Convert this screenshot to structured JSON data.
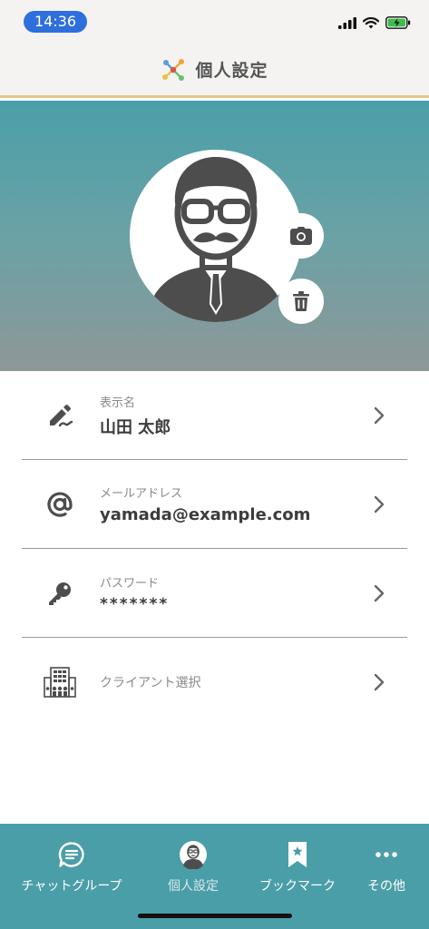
{
  "status_bar": {
    "time": "14:36"
  },
  "header": {
    "title": "個人設定"
  },
  "profile": {
    "camera_icon": "camera-icon",
    "trash_icon": "trash-icon"
  },
  "list": {
    "items": [
      {
        "icon": "pencil-icon",
        "label": "表示名",
        "value": "山田 太郎"
      },
      {
        "icon": "at-sign-icon",
        "label": "メールアドレス",
        "value": "yamada@example.com"
      },
      {
        "icon": "key-icon",
        "label": "パスワード",
        "value": "*******"
      },
      {
        "icon": "building-icon",
        "label": "クライアント選択"
      }
    ]
  },
  "bottom_nav": {
    "items": [
      {
        "label": "チャットグループ",
        "icon": "chat-icon"
      },
      {
        "label": "個人設定",
        "icon": "avatar-icon",
        "active": true
      },
      {
        "label": "ブックマーク",
        "icon": "bookmark-icon"
      },
      {
        "label": "その他",
        "icon": "more-icon"
      }
    ]
  },
  "colors": {
    "accent": "#4a9ea8",
    "time_pill": "#2f6fdc",
    "header_border": "#e0c88c"
  }
}
